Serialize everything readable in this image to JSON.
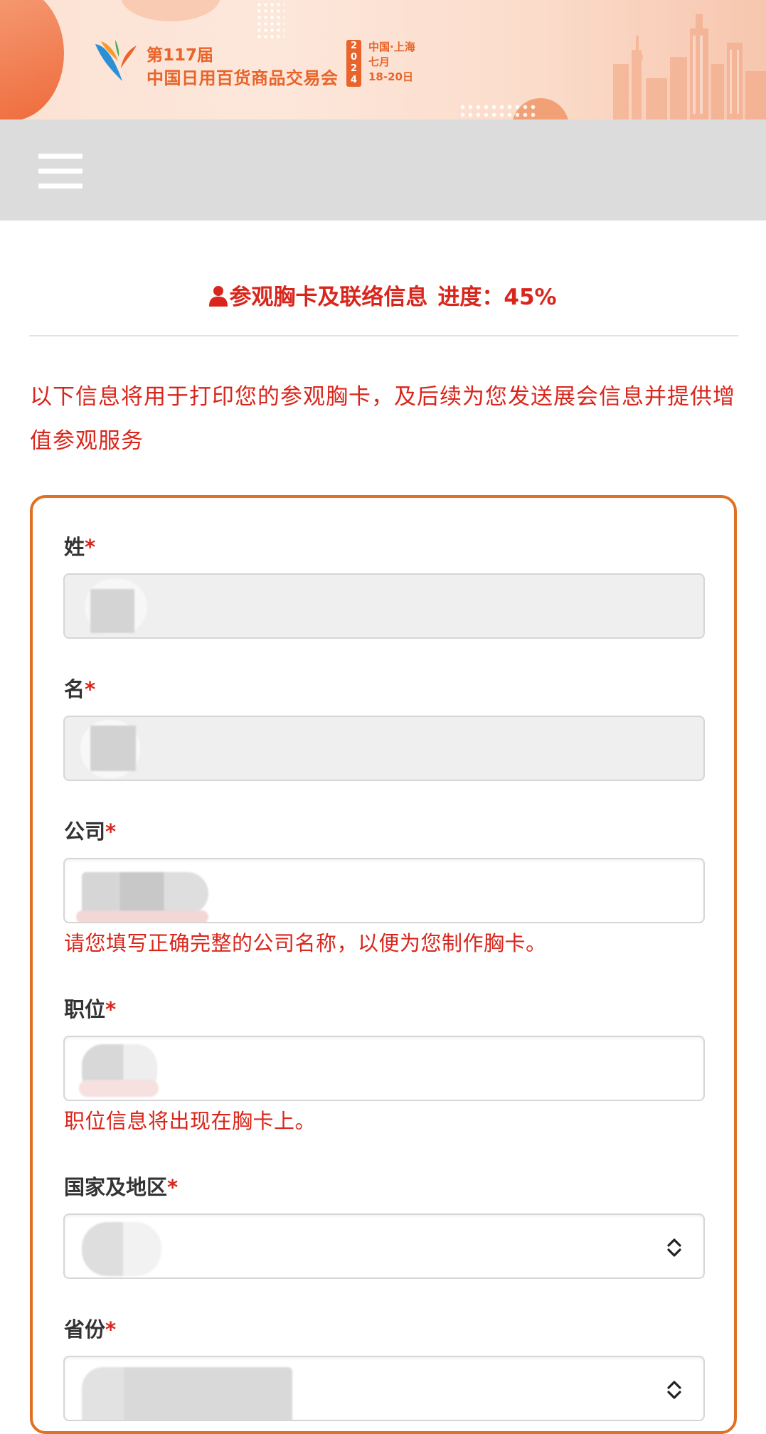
{
  "banner": {
    "title_line1": "第117届",
    "title_line2": "中国日用百货商品交易会",
    "year_digits": [
      "2",
      "0",
      "2",
      "4"
    ],
    "location": "中国·上海",
    "month": "七月",
    "dates": "18-20日",
    "brand_color": "#e8642a"
  },
  "nav": {
    "menu_icon": "hamburger-menu-icon"
  },
  "section": {
    "title": "参观胸卡及联络信息",
    "progress_label": "进度：",
    "progress_value": "45%",
    "progress_fraction": 0.45,
    "icon": "user-icon",
    "accent_color": "#d9261c"
  },
  "notice": {
    "text": "以下信息将用于打印您的参观胸卡，及后续为您发送展会信息并提供增值参观服务"
  },
  "form": {
    "border_color": "#e07024",
    "required_mark": "*",
    "fields": [
      {
        "label": "姓",
        "value": "",
        "type": "text",
        "readonly": true
      },
      {
        "label": "名",
        "value": "",
        "type": "text",
        "readonly": true
      },
      {
        "label": "公司",
        "value": "",
        "type": "text",
        "readonly": false,
        "hint": "请您填写正确完整的公司名称，以便为您制作胸卡。"
      },
      {
        "label": "职位",
        "value": "",
        "type": "text",
        "readonly": false,
        "hint": "职位信息将出现在胸卡上。"
      },
      {
        "label": "国家及地区",
        "value": "",
        "type": "select",
        "icon": "select-updown-icon"
      },
      {
        "label": "省份",
        "value": "",
        "type": "select",
        "icon": "select-updown-icon"
      }
    ]
  }
}
